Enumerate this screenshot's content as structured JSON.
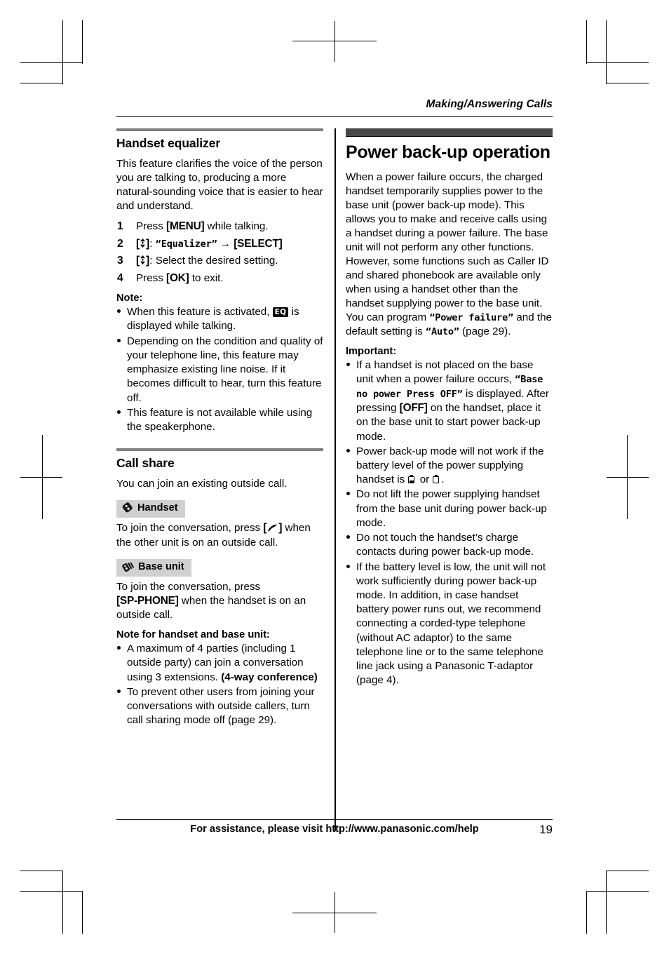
{
  "header": {
    "running_head": "Making/Answering Calls"
  },
  "left_column": {
    "section1": {
      "heading": "Handset equalizer",
      "intro": "This feature clarifies the voice of the person you are talking to, producing a more natural-sounding voice that is easier to hear and understand.",
      "steps": [
        {
          "num": "1",
          "pre": "Press ",
          "key": "[MENU]",
          "post": " while talking."
        },
        {
          "num": "2",
          "nav": "[↕]",
          "colon": ": ",
          "lcd": "“Equalizer”",
          "arrow": " → ",
          "key": "[SELECT]"
        },
        {
          "num": "3",
          "nav": "[↕]",
          "text": ": Select the desired setting."
        },
        {
          "num": "4",
          "pre": "Press ",
          "key": "[OK]",
          "post": " to exit."
        }
      ],
      "note_label": "Note:",
      "notes": [
        {
          "pre": "When this feature is activated, ",
          "icon": "EQ",
          "post": " is displayed while talking."
        },
        {
          "text": "Depending on the condition and quality of your telephone line, this feature may emphasize existing line noise. If it becomes difficult to hear, turn this feature off."
        },
        {
          "text": "This feature is not available while using the speakerphone."
        }
      ]
    },
    "section2": {
      "heading": "Call share",
      "intro": "You can join an existing outside call.",
      "handset_badge": "Handset",
      "handset_text_pre": "To join the conversation, press ",
      "handset_key": "[↖]",
      "handset_text_post": " when the other unit is on an outside call.",
      "base_badge": "Base unit",
      "base_text_pre": "To join the conversation, press ",
      "base_key": "[SP-PHONE]",
      "base_text_post": " when the handset is on an outside call.",
      "note_label": "Note for handset and base unit:",
      "notes": [
        {
          "text": "A maximum of 4 parties (including 1 outside party) can join a conversation using 3 extensions. ",
          "bold_tail": "(4-way conference)"
        },
        {
          "text": "To prevent other users from joining your conversations with outside callers, turn call sharing mode off (page 29)."
        }
      ]
    }
  },
  "right_column": {
    "heading": "Power back-up operation",
    "intro_part1": "When a power failure occurs, the charged handset temporarily supplies power to the base unit (power back-up mode). This allows you to make and receive calls using a handset during a power failure. The base unit will not perform any other functions. However, some functions such as Caller ID and shared phonebook are available only when using a handset other than the handset supplying power to the base unit. You can program ",
    "intro_lcd1": "“Power failure”",
    "intro_part2": " and the default setting is ",
    "intro_lcd2": "“Auto”",
    "intro_part3": " (page 29).",
    "important_label": "Important:",
    "important": [
      {
        "pre": "If a handset is not placed on the base unit when a power failure occurs, ",
        "lcd": "“Base no power Press OFF”",
        "mid": " is displayed. After pressing ",
        "key": "[OFF]",
        "post": " on the handset, place it on the base unit to start power back-up mode."
      },
      {
        "pre": "Power back-up mode will not work if the battery level of the power supplying handset is ",
        "battery1": "battery-low-icon",
        "mid": " or ",
        "battery2": "battery-empty-icon",
        "post": "."
      },
      {
        "text": "Do not lift the power supplying handset from the base unit during power back-up mode."
      },
      {
        "text": "Do not touch the handset’s charge contacts during power back-up mode."
      },
      {
        "text": "If the battery level is low, the unit will not work sufficiently during power back-up mode. In addition, in case handset battery power runs out, we recommend connecting a corded-type telephone (without AC adaptor) to the same telephone line or to the same telephone line jack using a Panasonic T-adaptor (page 4)."
      }
    ]
  },
  "footer": {
    "text": "For assistance, please visit http://www.panasonic.com/help",
    "page_number": "19"
  },
  "colors": {
    "rule_gray_thin": "#808080",
    "rule_gray_thick": "#474747",
    "badge_bg": "#d0d0d0",
    "text": "#000000"
  }
}
